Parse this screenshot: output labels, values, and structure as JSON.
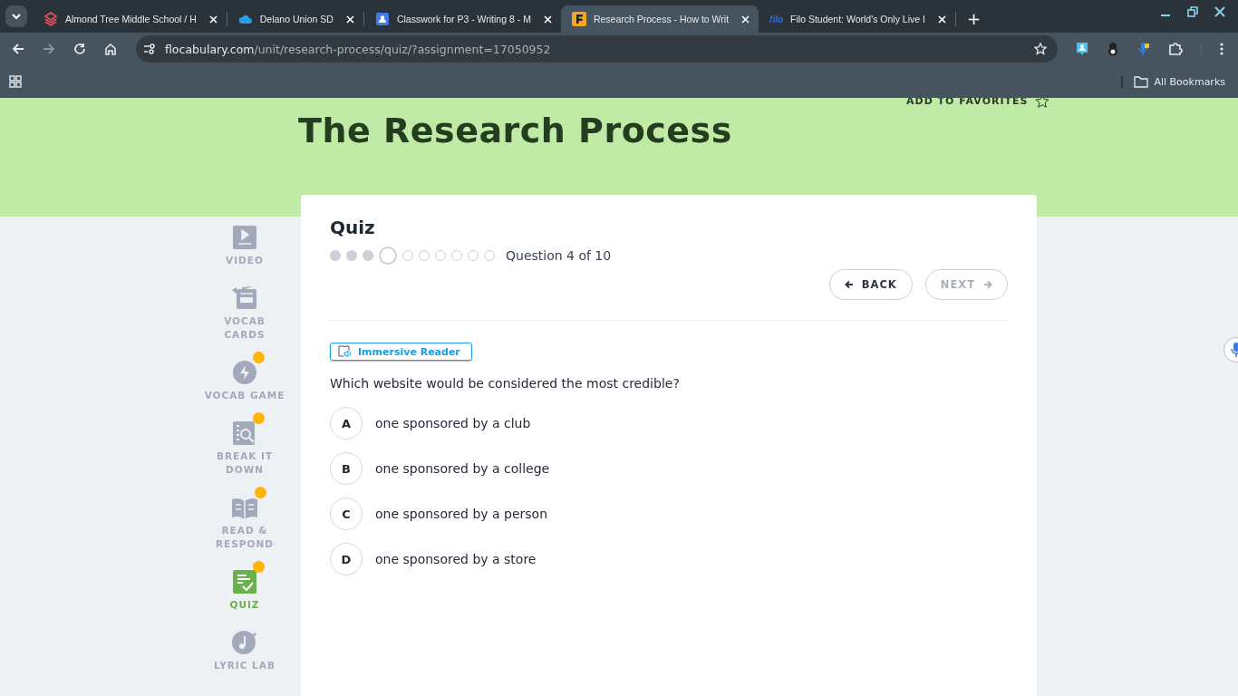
{
  "browser": {
    "tabs": [
      {
        "title": "Almond Tree Middle School / H",
        "selected": false
      },
      {
        "title": "Delano Union SD",
        "selected": false
      },
      {
        "title": "Classwork for P3 - Writing 8 - M",
        "selected": false
      },
      {
        "title": "Research Process - How to Writ",
        "selected": true
      },
      {
        "title": "Filo Student: World's Only Live I",
        "selected": false
      }
    ],
    "tab_icon_text": "filo",
    "new_tab": "+",
    "url": {
      "domain": "flocabulary.com",
      "path": "/unit/research-process/quiz/?assignment=17050952"
    },
    "bookmarks": "All Bookmarks"
  },
  "header": {
    "favorites": "ADD TO FAVORITES",
    "title": "The Research Process"
  },
  "sidebar": {
    "items": [
      {
        "label": "VIDEO",
        "kind": "video",
        "badge": false,
        "selected": false
      },
      {
        "label": "VOCAB CARDS",
        "kind": "cards",
        "badge": false,
        "selected": false
      },
      {
        "label": "VOCAB GAME",
        "kind": "game",
        "badge": true,
        "selected": false
      },
      {
        "label": "BREAK IT DOWN",
        "kind": "break",
        "badge": true,
        "selected": false
      },
      {
        "label": "READ & RESPOND",
        "kind": "read",
        "badge": true,
        "selected": false
      },
      {
        "label": "QUIZ",
        "kind": "quiz",
        "badge": true,
        "selected": true
      },
      {
        "label": "LYRIC LAB",
        "kind": "lyric",
        "badge": false,
        "selected": false
      }
    ]
  },
  "quiz": {
    "title": "Quiz",
    "progress": [
      {
        "kind": "done"
      },
      {
        "kind": "done"
      },
      {
        "kind": "done"
      },
      {
        "kind": "current"
      },
      {
        "kind": "todo"
      },
      {
        "kind": "todo"
      },
      {
        "kind": "todo"
      },
      {
        "kind": "todo"
      },
      {
        "kind": "todo"
      },
      {
        "kind": "todo"
      }
    ],
    "progress_text": "Question 4 of 10",
    "back": {
      "label": "BACK",
      "disabled": false
    },
    "next": {
      "label": "NEXT",
      "disabled": true
    },
    "immersive_reader": "Immersive Reader",
    "question": "Which website would be considered the most credible?",
    "options": [
      {
        "letter": "A",
        "text": "one sponsored by a club",
        "selected": false
      },
      {
        "letter": "B",
        "text": "one sponsored by a college",
        "selected": false
      },
      {
        "letter": "C",
        "text": "one sponsored by a person",
        "selected": false
      },
      {
        "letter": "D",
        "text": "one sponsored by a store",
        "selected": false
      }
    ]
  }
}
